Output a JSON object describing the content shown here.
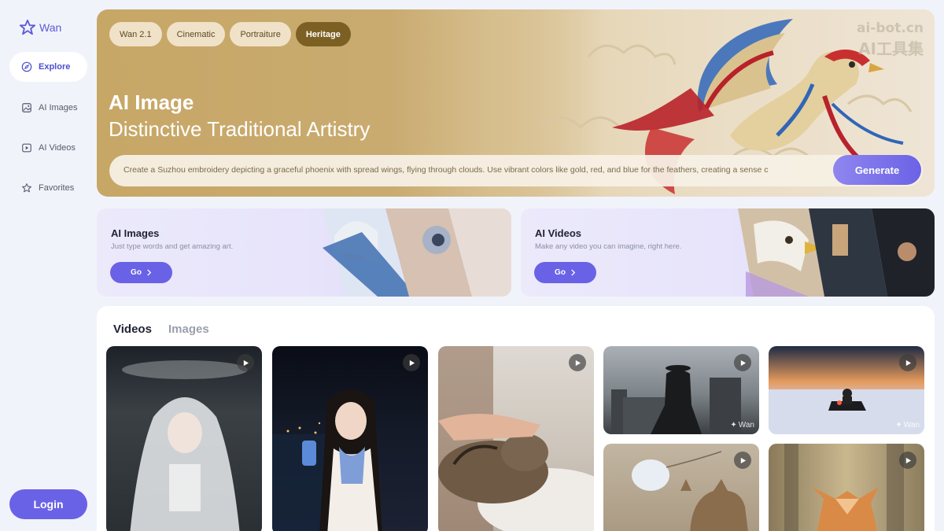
{
  "app": {
    "logo_text": "Wan"
  },
  "sidebar": {
    "items": [
      {
        "label": "Explore",
        "icon": "compass-icon",
        "active": true
      },
      {
        "label": "AI Images",
        "icon": "image-icon",
        "active": false
      },
      {
        "label": "AI Videos",
        "icon": "video-icon",
        "active": false
      },
      {
        "label": "Favorites",
        "icon": "star-icon",
        "active": false
      }
    ],
    "login_label": "Login"
  },
  "hero": {
    "pills": [
      "Wan 2.1",
      "Cinematic",
      "Portraiture",
      "Heritage"
    ],
    "active_pill": "Heritage",
    "title": "AI Image",
    "subtitle": "Distinctive Traditional Artistry",
    "prompt": "Create a Suzhou embroidery depicting a graceful phoenix with spread wings, flying through clouds. Use vibrant colors like gold, red, and blue for the feathers, creating a sense c",
    "generate_label": "Generate"
  },
  "features": [
    {
      "title": "AI Images",
      "subtitle": "Just type words and get amazing art.",
      "button": "Go"
    },
    {
      "title": "AI Videos",
      "subtitle": "Make any video you can imagine, right here.",
      "button": "Go"
    }
  ],
  "gallery": {
    "tabs": [
      "Videos",
      "Images"
    ],
    "active_tab": "Videos",
    "tile_watermark": "Wan"
  },
  "watermark": {
    "line1": "ai-bot.cn",
    "line2": "AI工具集"
  },
  "colors": {
    "accent": "#6a62e6",
    "hero_gold": "#c7a766",
    "heritage_pill": "#7c6023"
  }
}
